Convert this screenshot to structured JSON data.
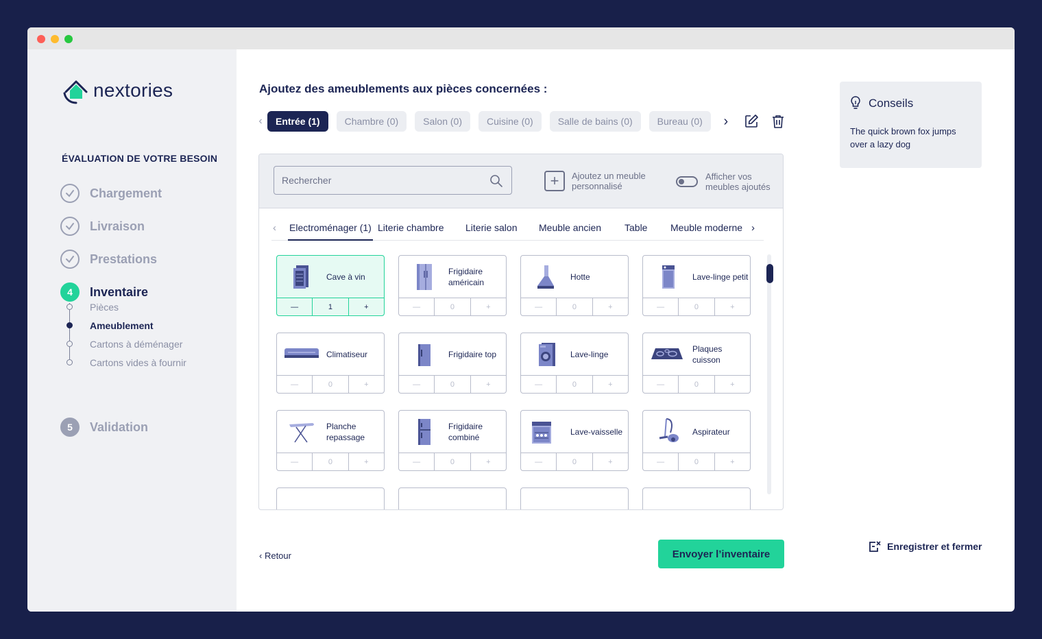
{
  "brand": {
    "name": "nextories",
    "accent": "#22d39a",
    "navy": "#1c2554"
  },
  "sidebar": {
    "section_title": "ÉVALUATION DE VOTRE BESOIN",
    "steps": [
      {
        "label": "Chargement",
        "state": "done"
      },
      {
        "label": "Livraison",
        "state": "done"
      },
      {
        "label": "Prestations",
        "state": "done"
      },
      {
        "label": "Inventaire",
        "number": "4",
        "state": "active"
      },
      {
        "label": "Validation",
        "number": "5",
        "state": "todo"
      }
    ],
    "substeps": [
      {
        "label": "Pièces"
      },
      {
        "label": "Ameublement",
        "active": true
      },
      {
        "label": "Cartons à déménager"
      },
      {
        "label": "Cartons vides à fournir"
      }
    ]
  },
  "main": {
    "title": "Ajoutez des ameublements aux pièces concernées :",
    "room_tabs": [
      "Entrée (1)",
      "Chambre (0)",
      "Salon (0)",
      "Cuisine (0)",
      "Salle de bains (0)",
      "Bureau (0)"
    ],
    "search_placeholder": "Rechercher",
    "add_custom_label": "Ajoutez un meuble personnalisé",
    "toggle_label": "Afficher vos meubles ajoutés",
    "category_tabs": [
      "Electroménager (1)",
      "Literie chambre",
      "Literie salon",
      "Meuble ancien",
      "Table",
      "Meuble moderne"
    ],
    "items": [
      {
        "name": "Cave à vin",
        "qty": "1",
        "icon": "wine-cellar-icon"
      },
      {
        "name": "Frigidaire américain",
        "qty": "0",
        "icon": "american-fridge-icon"
      },
      {
        "name": "Hotte",
        "qty": "0",
        "icon": "hood-icon"
      },
      {
        "name": "Lave-linge petit",
        "qty": "0",
        "icon": "small-washer-icon"
      },
      {
        "name": "Climatiseur",
        "qty": "0",
        "icon": "air-conditioner-icon"
      },
      {
        "name": "Frigidaire top",
        "qty": "0",
        "icon": "fridge-top-icon"
      },
      {
        "name": "Lave-linge",
        "qty": "0",
        "icon": "washing-machine-icon"
      },
      {
        "name": "Plaques cuisson",
        "qty": "0",
        "icon": "cooktop-icon"
      },
      {
        "name": "Planche repassage",
        "qty": "0",
        "icon": "ironing-board-icon"
      },
      {
        "name": "Frigidaire combiné",
        "qty": "0",
        "icon": "combi-fridge-icon"
      },
      {
        "name": "Lave-vaisselle",
        "qty": "0",
        "icon": "dishwasher-icon"
      },
      {
        "name": "Aspirateur",
        "qty": "0",
        "icon": "vacuum-icon"
      }
    ],
    "counter_minus": "—",
    "counter_plus": "+",
    "back_label": "Retour",
    "send_label": "Envoyer l’inventaire"
  },
  "tips": {
    "title": "Conseils",
    "body": "The quick brown fox jumps over a lazy dog"
  },
  "save_close_label": "Enregistrer et fermer"
}
